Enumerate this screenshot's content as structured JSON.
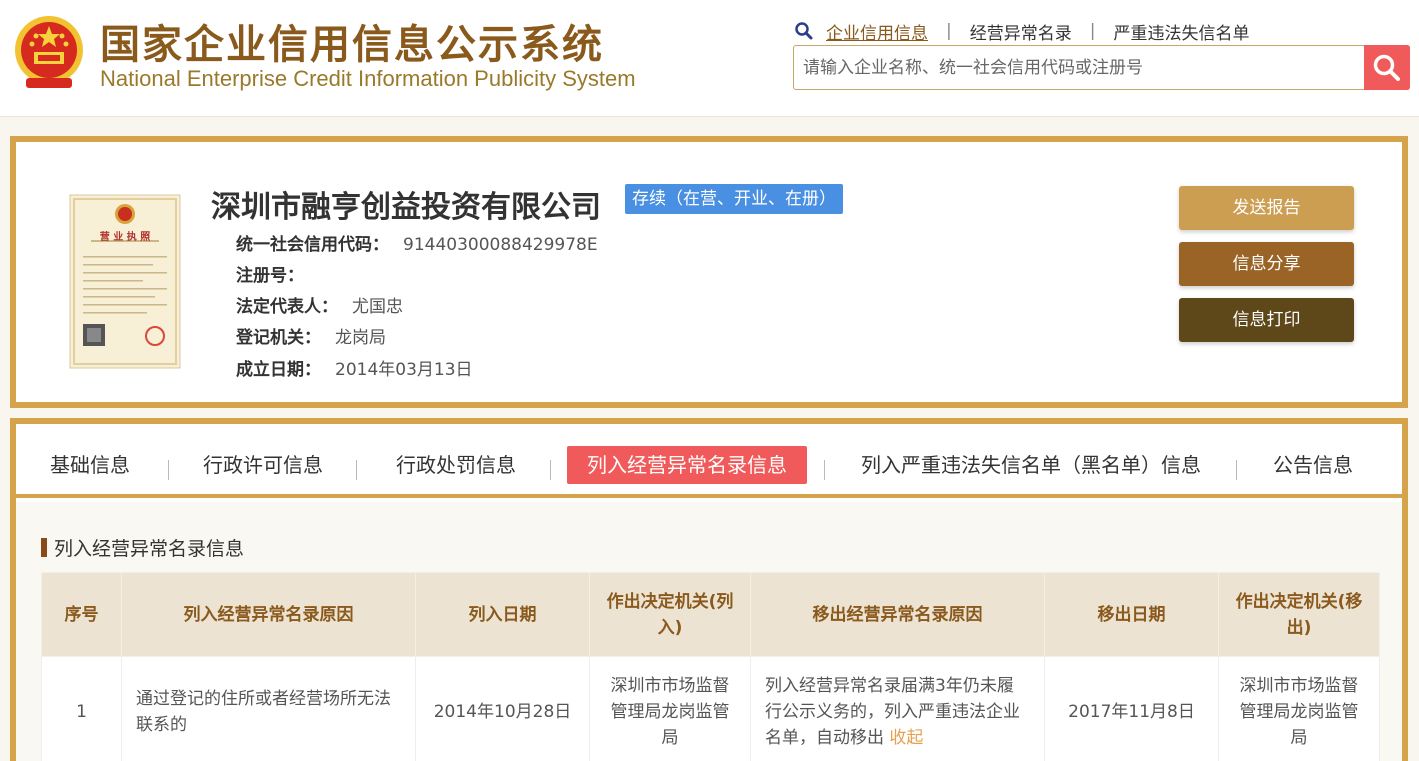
{
  "header": {
    "title_cn": "国家企业信用信息公示系统",
    "title_en": "National Enterprise Credit Information Publicity System",
    "nav": [
      "企业信用信息",
      "经营异常名录",
      "严重违法失信名单"
    ],
    "nav_separator": "|",
    "search_placeholder": "请输入企业名称、统一社会信用代码或注册号",
    "accent_color": "#8a5a1c",
    "search_button_color": "#f05a5a"
  },
  "company": {
    "name": "深圳市融亨创益投资有限公司",
    "status": "存续（在营、开业、在册）",
    "license_title": "营 业 执 照",
    "fields": [
      {
        "label": "统一社会信用代码：",
        "value": "91440300088429978E"
      },
      {
        "label": "注册号：",
        "value": ""
      },
      {
        "label": "法定代表人：",
        "value": "尤国忠"
      },
      {
        "label": "登记机关：",
        "value": "龙岗局"
      },
      {
        "label": "成立日期：",
        "value": "2014年03月13日"
      }
    ],
    "actions": [
      "发送报告",
      "信息分享",
      "信息打印"
    ]
  },
  "tabs": [
    "基础信息",
    "行政许可信息",
    "行政处罚信息",
    "列入经营异常名录信息",
    "列入严重违法失信名单（黑名单）信息",
    "公告信息"
  ],
  "active_tab": "列入经营异常名录信息",
  "section": {
    "title": "列入经营异常名录信息",
    "columns": [
      "序号",
      "列入经营异常名录原因",
      "列入日期",
      "作出决定机关(列入)",
      "移出经营异常名录原因",
      "移出日期",
      "作出决定机关(移出)"
    ],
    "rows": [
      {
        "index": "1",
        "reason_in": "通过登记的住所或者经营场所无法联系的",
        "date_in": "2014年10月28日",
        "authority_in": "深圳市市场监督管理局龙岗监管局",
        "reason_out": "列入经营异常名录届满3年仍未履行公示义务的，列入严重违法企业名单，自动移出",
        "collapse_label": "收起",
        "date_out": "2017年11月8日",
        "authority_out": "深圳市市场监督管理局龙岗监管局"
      }
    ]
  }
}
